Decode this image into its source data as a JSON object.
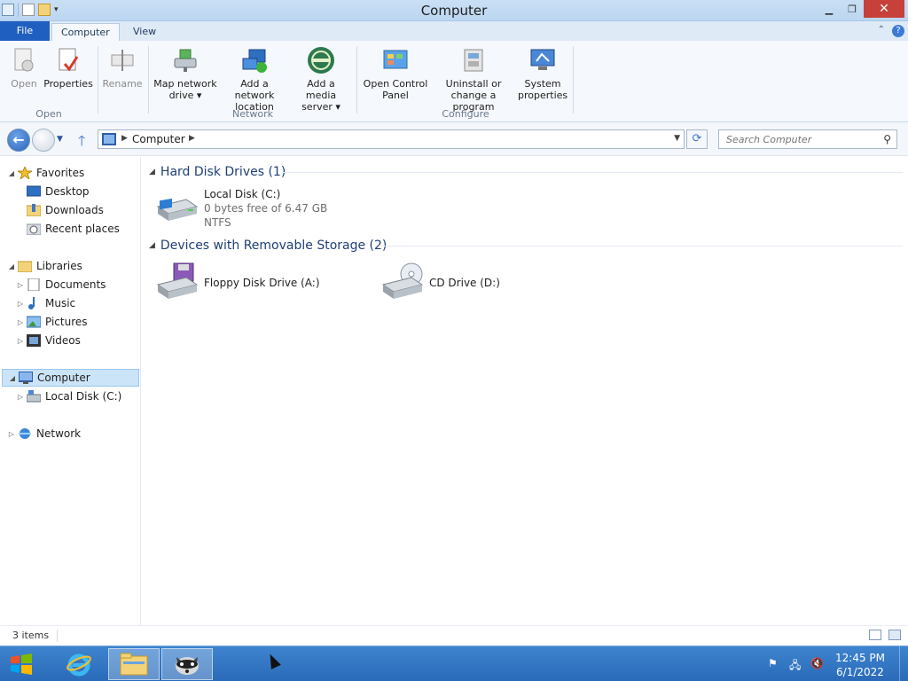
{
  "window": {
    "title": "Computer"
  },
  "ribbon": {
    "tabs": [
      {
        "label": "File"
      },
      {
        "label": "Computer"
      },
      {
        "label": "View"
      }
    ],
    "groups": [
      {
        "label": "Open"
      },
      {
        "label": "Network"
      },
      {
        "label": "Configure"
      }
    ],
    "buttons": {
      "open": "Open",
      "properties": "Properties",
      "rename": "Rename",
      "map_network_drive_1": "Map network",
      "map_network_drive_2": "drive ▾",
      "add_network_location_1": "Add a network",
      "add_network_location_2": "location",
      "add_media_server_1": "Add a media",
      "add_media_server_2": "server ▾",
      "open_control_panel_1": "Open Control",
      "open_control_panel_2": "Panel",
      "uninstall_1": "Uninstall or",
      "uninstall_2": "change a program",
      "system_properties_1": "System",
      "system_properties_2": "properties"
    }
  },
  "address_bar": {
    "path": "Computer",
    "search_placeholder": "Search Computer"
  },
  "nav_pane": {
    "favorites": "Favorites",
    "desktop": "Desktop",
    "downloads": "Downloads",
    "recent_places": "Recent places",
    "libraries": "Libraries",
    "documents": "Documents",
    "music": "Music",
    "pictures": "Pictures",
    "videos": "Videos",
    "computer": "Computer",
    "local_disk": "Local Disk (C:)",
    "network": "Network"
  },
  "content": {
    "hard_disk_header": "Hard Disk Drives (1)",
    "removable_header": "Devices with Removable Storage (2)",
    "local_disk": {
      "name": "Local Disk (C:)",
      "free": "0 bytes free of 6.47 GB",
      "fs": "NTFS"
    },
    "floppy": {
      "name": "Floppy Disk Drive (A:)"
    },
    "cd": {
      "name": "CD Drive (D:)"
    }
  },
  "status_bar": {
    "items": "3 items"
  },
  "taskbar": {
    "time": "12:45 PM",
    "date": "6/1/2022"
  },
  "colors": {
    "accent": "#1f5fbf",
    "taskbar": "#2a6ab8",
    "selected": "#cce4f7"
  }
}
